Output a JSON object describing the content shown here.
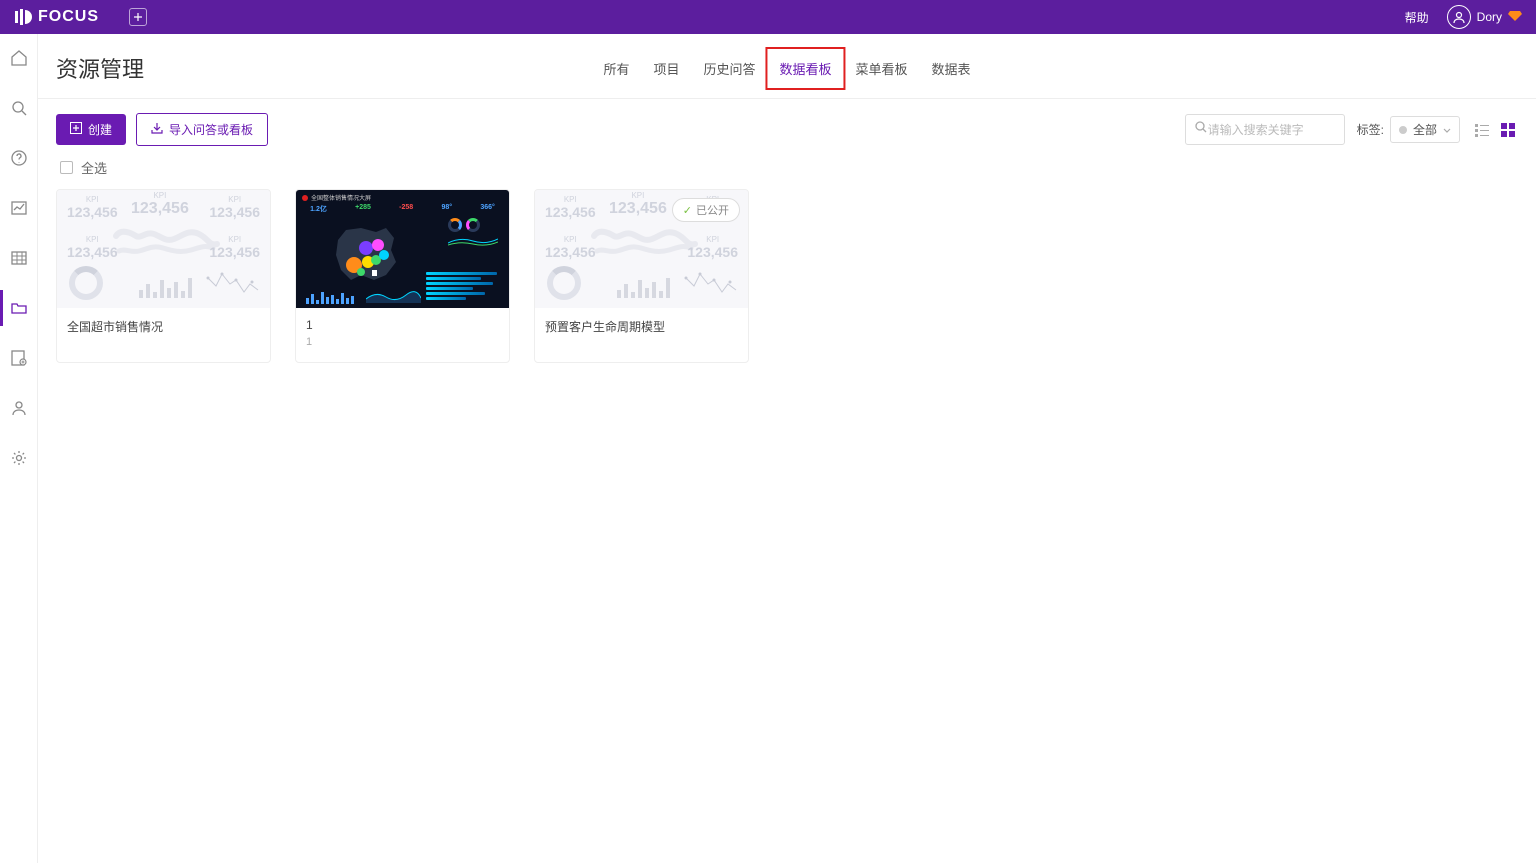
{
  "app": {
    "name": "FOCUS"
  },
  "topbar": {
    "help": "帮助",
    "username": "Dory"
  },
  "page": {
    "title": "资源管理"
  },
  "tabs": {
    "all": "所有",
    "project": "项目",
    "history": "历史问答",
    "dashboard": "数据看板",
    "menu_dashboard": "菜单看板",
    "data_table": "数据表"
  },
  "toolbar": {
    "create": "创建",
    "import": "导入问答或看板",
    "search_placeholder": "请输入搜索关键字",
    "label": "标签:",
    "label_all": "全部"
  },
  "select_all": "全选",
  "cards": {
    "c1": {
      "title": "全国超市销售情况"
    },
    "c2": {
      "title": "1",
      "subtitle": "1"
    },
    "c3": {
      "title": "预置客户生命周期模型",
      "status": "已公开"
    }
  },
  "placeholder": {
    "kpi_value": "123,456",
    "kpi_label": "KPI"
  }
}
